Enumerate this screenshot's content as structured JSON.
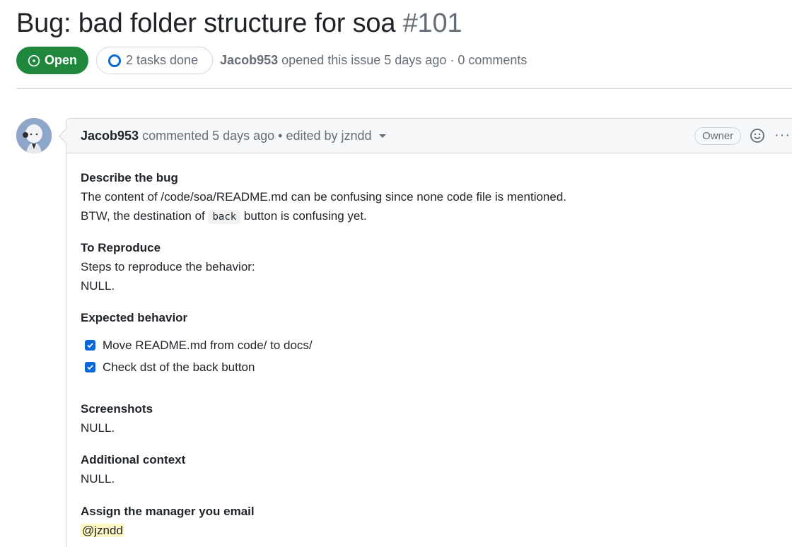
{
  "issue": {
    "title": "Bug: bad folder structure for soa",
    "number": "#101",
    "state": "Open",
    "tasks": "2 tasks done",
    "author": "Jacob953",
    "opened_text": "opened this issue 5 days ago · 0 comments"
  },
  "comment": {
    "author": "Jacob953",
    "meta": "commented 5 days ago • edited by jzndd",
    "role": "Owner",
    "more": "···",
    "sections": {
      "describe_heading": "Describe the bug",
      "describe_line1": "The content of /code/soa/README.md can be confusing since none code file is mentioned.",
      "describe_line2_pre": "BTW, the destination of ",
      "describe_code": "back",
      "describe_line2_post": " button is confusing yet.",
      "reproduce_heading": "To Reproduce",
      "reproduce_line1": "Steps to reproduce the behavior:",
      "reproduce_line2": "NULL.",
      "expected_heading": "Expected behavior",
      "task1": "Move README.md from code/ to docs/",
      "task2": "Check dst of the back button",
      "screenshots_heading": "Screenshots",
      "screenshots_text": "NULL.",
      "context_heading": "Additional context",
      "context_text": "NULL.",
      "assign_heading": "Assign the manager you email",
      "mention": "@jzndd"
    }
  },
  "colors": {
    "open_green": "#1f883d",
    "accent_blue": "#0969da",
    "muted": "#656d76"
  }
}
